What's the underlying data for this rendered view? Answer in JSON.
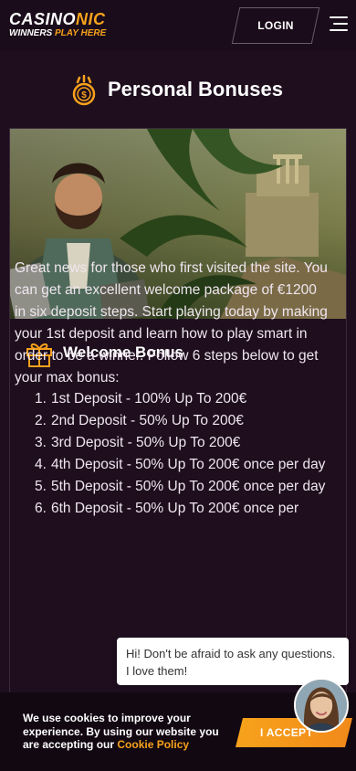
{
  "header": {
    "logo_part1": "CASINO",
    "logo_part2": "NIC",
    "tagline_part1": "WINNERS",
    "tagline_part2": "PLAY HERE",
    "login_label": "LOGIN",
    "menu_icon": "hamburger-icon"
  },
  "page": {
    "title": "Personal Bonuses",
    "title_icon": "coin-stack-icon"
  },
  "bonus": {
    "icon": "gift-icon",
    "title": "Welcome Bonus",
    "description": "Great news for those who first visited the site. You can get an excellent welcome package of €1200 in six deposit steps. Start playing today by making your 1st deposit and learn how to play smart in order to be a winner. Follow 6 steps below to get your max bonus:",
    "steps": [
      {
        "num": "1.",
        "text": "1st Deposit - 100% Up To 200€"
      },
      {
        "num": "2.",
        "text": "2nd Deposit - 50% Up To 200€"
      },
      {
        "num": "3.",
        "text": "3rd Deposit - 50% Up To 200€"
      },
      {
        "num": "4.",
        "text": "4th Deposit - 50% Up To 200€ once per day"
      },
      {
        "num": "5.",
        "text": "5th Deposit - 50% Up To 200€ once per day"
      },
      {
        "num": "6.",
        "text": "6th Deposit - 50% Up To 200€ once per"
      }
    ]
  },
  "chat": {
    "message": "Hi! Don't be afraid to ask any questions. I love them!"
  },
  "cookie": {
    "text": "We use cookies to improve your experience. By using our website you are accepting our",
    "link": "Cookie Policy",
    "accept_label": "I ACCEPT"
  },
  "colors": {
    "accent": "#f7a21b",
    "background": "#1e0e1e"
  }
}
